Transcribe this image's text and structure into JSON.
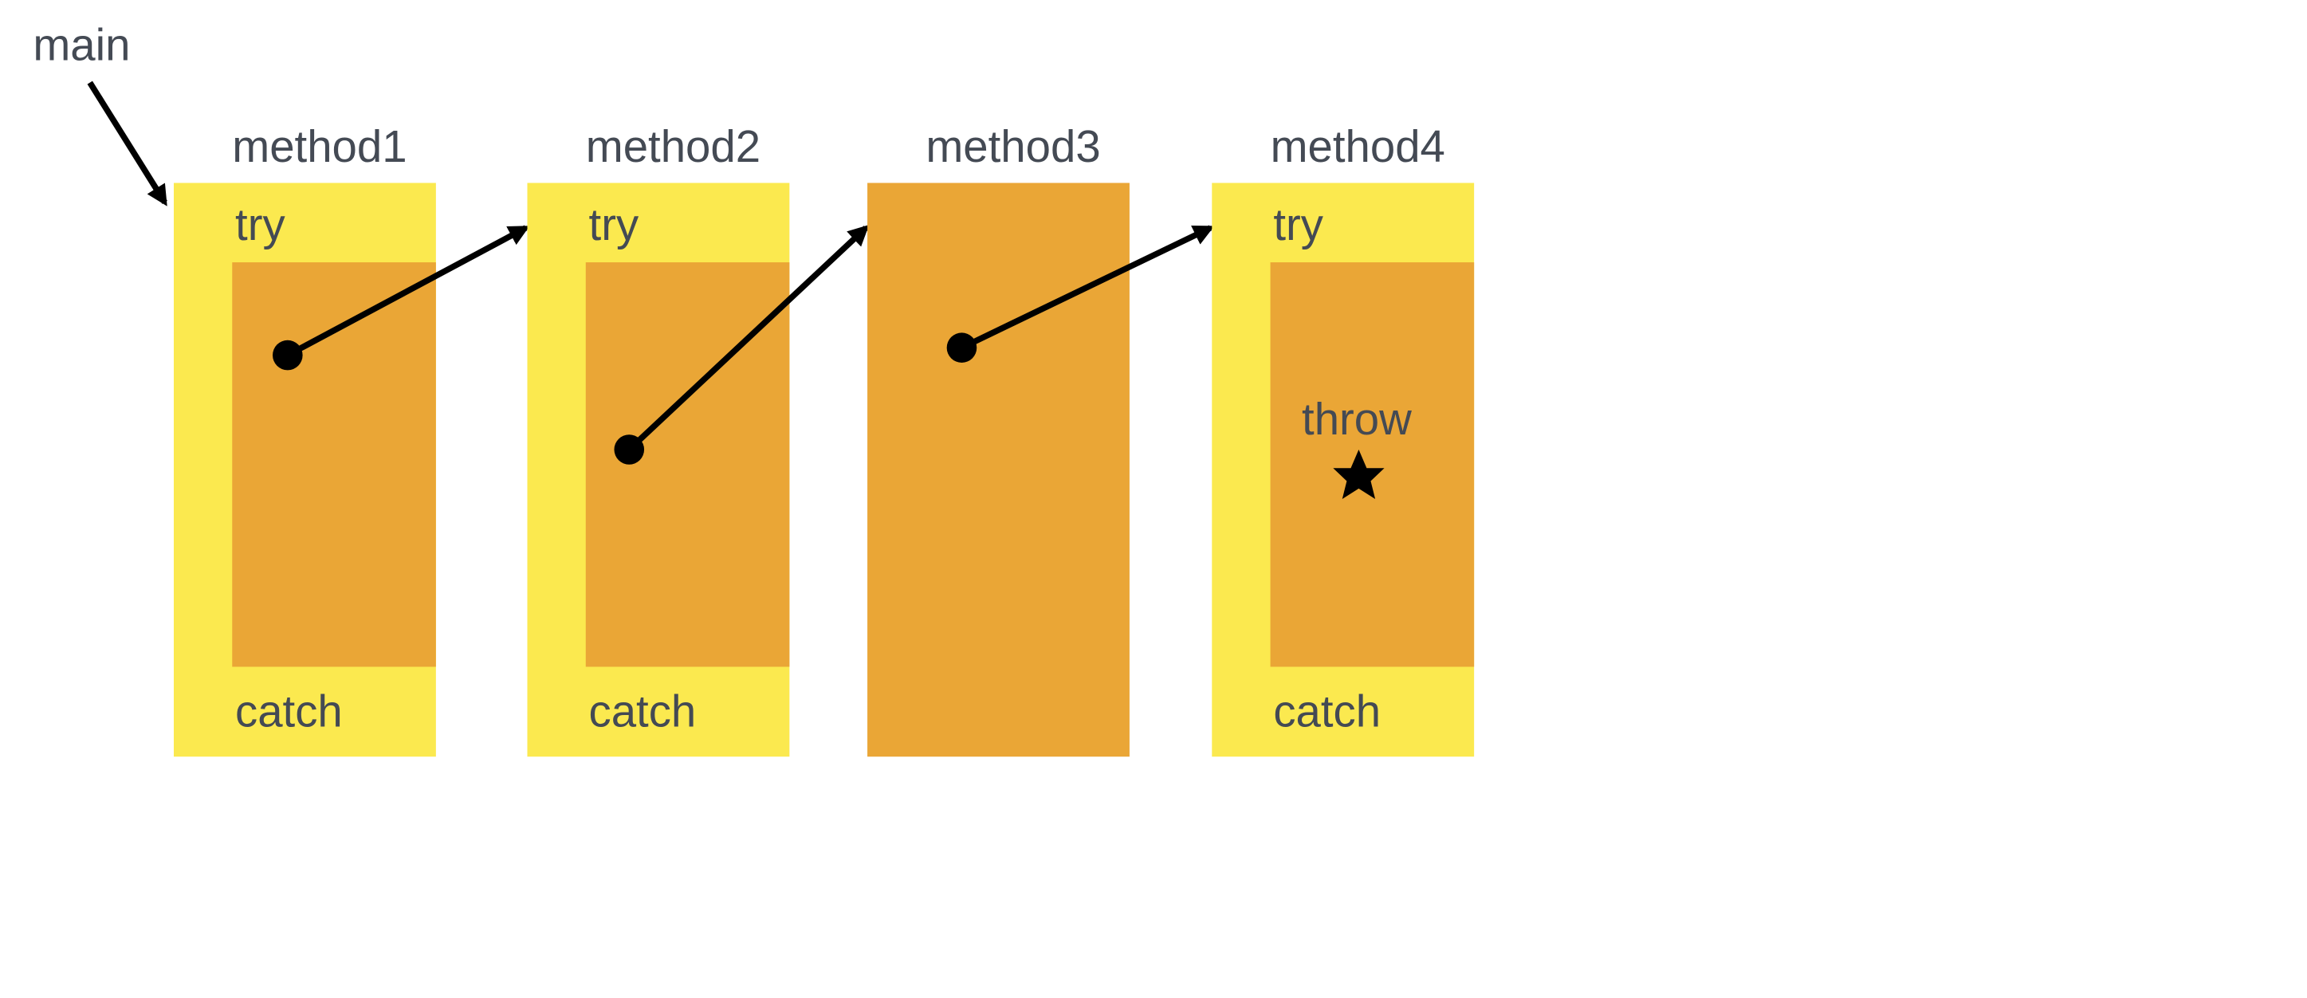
{
  "diagram": {
    "main_label": "main",
    "throw_label": "throw",
    "colors": {
      "outer": "#fbe94f",
      "inner": "#eaa636",
      "text": "#444a54",
      "stroke": "#000000"
    },
    "methods": [
      {
        "name": "method1",
        "has_try_catch": true
      },
      {
        "name": "method2",
        "has_try_catch": true
      },
      {
        "name": "method3",
        "has_try_catch": false
      },
      {
        "name": "method4",
        "has_try_catch": true
      }
    ],
    "try_label": "try",
    "catch_label": "catch"
  }
}
